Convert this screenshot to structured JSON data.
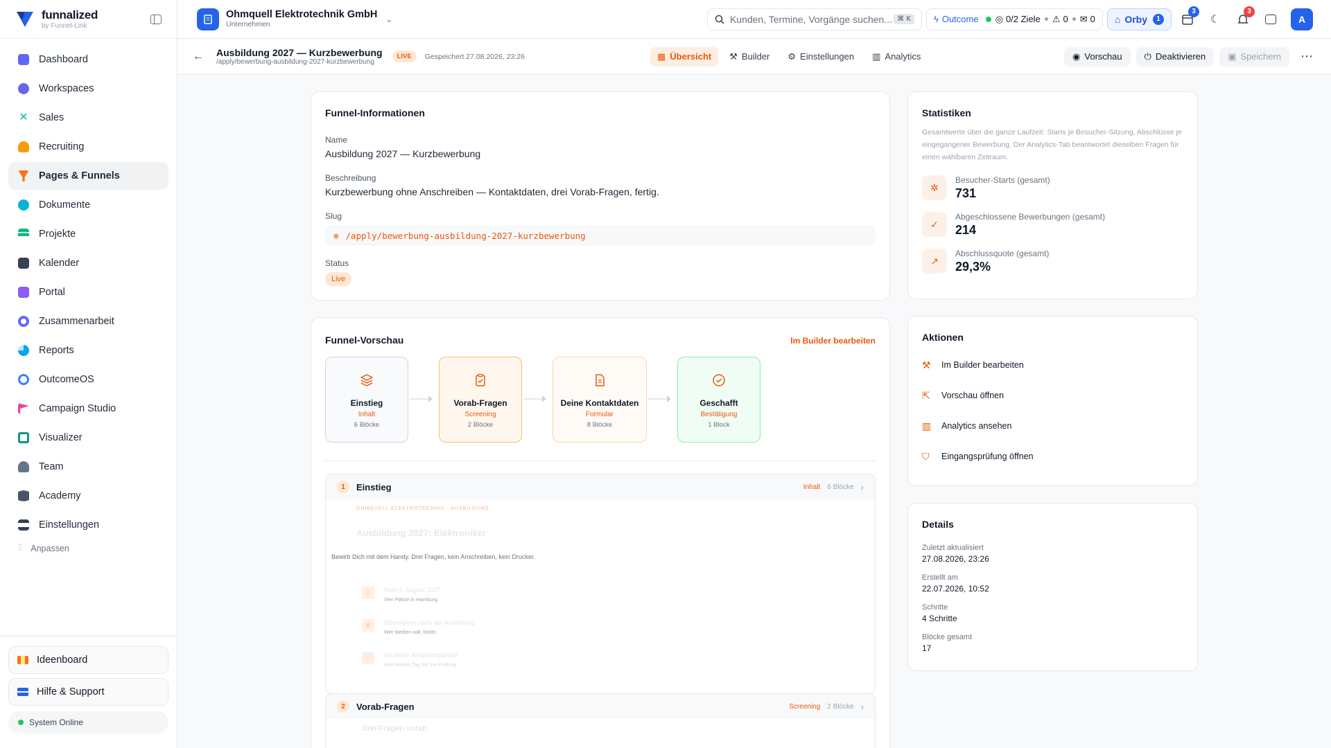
{
  "app": {
    "name": "funnalized",
    "sub": "by Funnel-Link"
  },
  "sidebar": {
    "items": [
      {
        "label": "Dashboard",
        "color": "#6366f1"
      },
      {
        "label": "Workspaces",
        "color": "#6366f1"
      },
      {
        "label": "Sales",
        "color": "#14b8a6"
      },
      {
        "label": "Recruiting",
        "color": "#f59e0b"
      },
      {
        "label": "Pages & Funnels",
        "color": "#f97316"
      },
      {
        "label": "Dokumente",
        "color": "#06b6d4"
      },
      {
        "label": "Projekte",
        "color": "#10b981"
      },
      {
        "label": "Kalender",
        "color": "#374151"
      },
      {
        "label": "Portal",
        "color": "#8b5cf6"
      },
      {
        "label": "Zusammenarbeit",
        "color": "#6366f1"
      },
      {
        "label": "Reports",
        "color": "#0ea5e9"
      },
      {
        "label": "OutcomeOS",
        "color": "#3b82f6"
      },
      {
        "label": "Campaign Studio",
        "color": "#ec4899"
      },
      {
        "label": "Visualizer",
        "color": "#0d9488"
      },
      {
        "label": "Team",
        "color": "#64748b"
      },
      {
        "label": "Academy",
        "color": "#475569"
      },
      {
        "label": "Einstellungen",
        "color": "#334155"
      }
    ],
    "adjust": "Anpassen",
    "ideaboard": "Ideenboard",
    "help": "Hilfe & Support",
    "system_status": "System Online"
  },
  "topbar": {
    "company_name": "Ohmquell Elektrotechnik GmbH",
    "company_type": "Unternehmen",
    "search_placeholder": "Kunden, Termine, Vorgänge suchen...",
    "search_kbd": "⌘ K",
    "outcome_label": "Outcome",
    "goals_label": "0/2 Ziele",
    "warn_count": "0",
    "mail_count": "0",
    "orby_label": "Orby",
    "orby_badge": "1",
    "calendar_badge": "3",
    "notif_badge": "3",
    "avatar": "A"
  },
  "page": {
    "title": "Ausbildung 2027 — Kurzbewerbung",
    "slug_small": "/apply/bewerbung-ausbildung-2027-kurzbewerbung",
    "status_badge": "LIVE",
    "saved_text": "Gespeichert 27.08.2026, 23:26",
    "tabs": [
      "Übersicht",
      "Builder",
      "Einstellungen",
      "Analytics"
    ],
    "preview_btn": "Vorschau",
    "deactivate_btn": "Deaktivieren",
    "save_btn": "Speichern"
  },
  "info": {
    "title": "Funnel-Informationen",
    "name_label": "Name",
    "name_value": "Ausbildung 2027 — Kurzbewerbung",
    "desc_label": "Beschreibung",
    "desc_value": "Kurzbewerbung ohne Anschreiben — Kontaktdaten, drei Vorab-Fragen, fertig.",
    "slug_label": "Slug",
    "slug_value": "/apply/bewerbung-ausbildung-2027-kurzbewerbung",
    "status_label": "Status",
    "status_value": "Live"
  },
  "preview": {
    "title": "Funnel-Vorschau",
    "edit_link": "Im Builder bearbeiten",
    "steps": [
      {
        "name": "Einstieg",
        "type": "Inhalt",
        "blocks": "6 Blöcke"
      },
      {
        "name": "Vorab-Fragen",
        "type": "Screening",
        "blocks": "2 Blöcke"
      },
      {
        "name": "Deine Kontaktdaten",
        "type": "Formular",
        "blocks": "8 Blöcke"
      },
      {
        "name": "Geschafft",
        "type": "Bestätigung",
        "blocks": "1 Block"
      }
    ],
    "sections": [
      {
        "num": "1",
        "name": "Einstieg",
        "type": "Inhalt",
        "blocks": "6 Blöcke"
      },
      {
        "num": "2",
        "name": "Vorab-Fragen",
        "type": "Screening",
        "blocks": "2 Blöcke"
      }
    ],
    "content": {
      "kicker": "OHMQUELL ELEKTROTECHNIK · AUSBILDUNG",
      "headline": "Ausbildung 2027: Elektroniker",
      "intro": "Bewirb Dich mit dem Handy. Drei Fragen, kein Anschreiben, kein Drucker.",
      "features": [
        {
          "title": "Start 1. August 2027",
          "sub": "Vier Plätze in Hamburg."
        },
        {
          "title": "Übernahme nach der Ausbildung",
          "sub": "Wer bleiben will, bleibt."
        },
        {
          "title": "Ein fester Ansprechpartner",
          "sub": "Vom ersten Tag bis zur Prüfung"
        }
      ],
      "section2_headline": "Drei Fragen vorab"
    }
  },
  "stats": {
    "title": "Statistiken",
    "desc": "Gesamtwerte über die ganze Laufzeit: Starts je Besucher-Sitzung, Abschlüsse je eingegangener Bewerbung. Der Analytics-Tab beantwortet dieselben Fragen für einen wählbaren Zeitraum.",
    "items": [
      {
        "label": "Besucher-Starts (gesamt)",
        "value": "731"
      },
      {
        "label": "Abgeschlossene Bewerbungen (gesamt)",
        "value": "214"
      },
      {
        "label": "Abschlussquote (gesamt)",
        "value": "29,3%"
      }
    ]
  },
  "actions": {
    "title": "Aktionen",
    "items": [
      "Im Builder bearbeiten",
      "Vorschau öffnen",
      "Analytics ansehen",
      "Eingangsprüfung öffnen"
    ]
  },
  "details": {
    "title": "Details",
    "items": [
      {
        "label": "Zuletzt aktualisiert",
        "value": "27.08.2026, 23:26"
      },
      {
        "label": "Erstellt am",
        "value": "22.07.2026, 10:52"
      },
      {
        "label": "Schritte",
        "value": "4 Schritte"
      },
      {
        "label": "Blöcke gesamt",
        "value": "17"
      }
    ]
  },
  "colors": {
    "accent": "#ea580c",
    "primary": "#2563eb",
    "success": "#22c55e"
  }
}
